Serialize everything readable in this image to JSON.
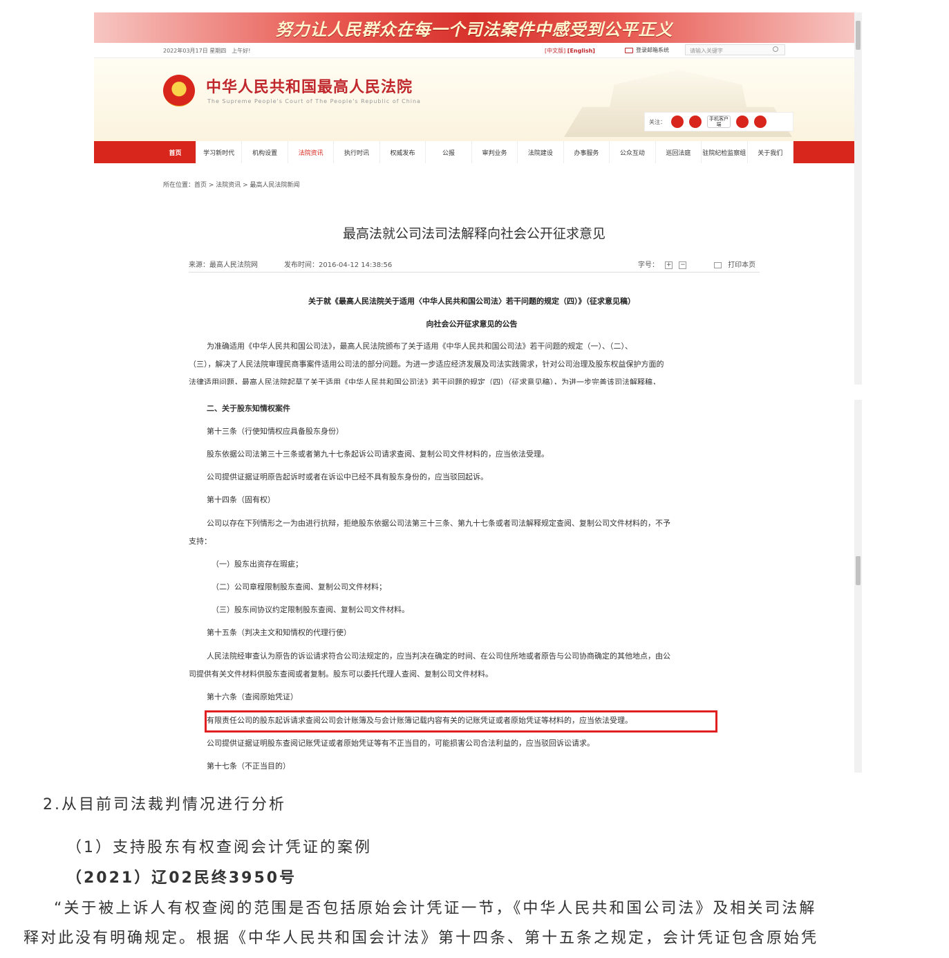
{
  "screenshot1": {
    "banner": "努力让人民群众在每一个司法案件中感受到公平正义",
    "topbar": {
      "date": "2022年03月17日 星期四　上午好!",
      "lang_cn": "[中文版]",
      "lang_en": "[English]",
      "mail": "登录邮箱系统",
      "search_placeholder": "请输入关键字"
    },
    "header": {
      "court_name": "中华人民共和国最高人民法院",
      "court_name_en": "The Supreme People's Court of The People's Republic of China",
      "follow_label": "关注：",
      "mobile_label": "手机客户端"
    },
    "nav": [
      "首页",
      "学习新时代",
      "机构设置",
      "法院资讯",
      "执行时讯",
      "权威发布",
      "公报",
      "审判业务",
      "法院建设",
      "办事服务",
      "公众互动",
      "巡回法庭",
      "驻院纪检监察组",
      "关于我们"
    ],
    "breadcrumb": "所在位置：首页 > 法院资讯 > 最高人民法院新闻",
    "article": {
      "title": "最高法就公司法司法解释向社会公开征求意见",
      "source": "来源：最高人民法院网",
      "time": "发布时间：2016-04-12 14:38:56",
      "font_label": "字号：",
      "font_plus": "+",
      "font_minus": "−",
      "print": "打印本页",
      "notice_title1": "关于就《最高人民法院关于适用〈中华人民共和国公司法〉若干问题的规定（四）》（征求意见稿）",
      "notice_title2": "向社会公开征求意见的公告",
      "para_line1": "为准确适用《中华人民共和国公司法》，最高人民法院颁布了关于适用《中华人民共和国公司法》若干问题的规定（一）、（二）、",
      "para_line2": "（三），解决了人民法院审理民商事案件适用公司法的部分问题。为进一步适应经济发展及司法实践需求，针对公司治理及股东权益保护方面的",
      "para_line3": "法律适用问题，最高人民法院起草了关于适用《中华人民共和国公司法》若干问题的规定（四）（征求意见稿），为进一步完善该司法解释稿，"
    }
  },
  "screenshot2": {
    "lines": [
      "二、关于股东知情权案件",
      "第十三条（行使知情权应具备股东身份）",
      "股东依据公司法第三十三条或者第九十七条起诉公司请求查阅、复制公司文件材料的，应当依法受理。",
      "公司提供证据证明原告起诉时或者在诉讼中已经不具有股东身份的，应当驳回起诉。",
      "第十四条（固有权）",
      "公司以存在下列情形之一为由进行抗辩，拒绝股东依据公司法第三十三条、第九十七条或者司法解释规定查阅、复制公司文件材料的，不予",
      "支持：",
      "（一）股东出资存在瑕疵；",
      "（二）公司章程限制股东查阅、复制公司文件材料；",
      "（三）股东间协议约定限制股东查阅、复制公司文件材料。",
      "第十五条（判决主文和知情权的代理行使）",
      "人民法院经审查认为原告的诉讼请求符合公司法规定的，应当判决在确定的时间、在公司住所地或者原告与公司协商确定的其他地点，由公",
      "司提供有关文件材料供股东查阅或者复制。股东可以委托代理人查阅、复制公司文件材料。",
      "第十六条（查阅原始凭证）",
      "有限责任公司的股东起诉请求查阅公司会计账簿及与会计账簿记载内容有关的记账凭证或者原始凭证等材料的，应当依法受理。",
      "公司提供证据证明股东查阅记账凭证或者原始凭证等有不正当目的，可能损害公司合法利益的，应当驳回诉讼请求。",
      "第十七条（不正当目的）"
    ]
  },
  "body": {
    "heading": "2.从目前司法裁判情况进行分析",
    "subheading": "（1）支持股东有权查阅会计凭证的案例",
    "case_number": "（2021）辽02民终3950号",
    "quote_line1": "“关于被上诉人有权查阅的范围是否包括原始会计凭证一节，《中华人民共和国公司法》及相关司法解",
    "quote_line2": "释对此没有明确规定。根据《中华人民共和国会计法》第十四条、第十五条之规定，会计凭证包含原始凭"
  },
  "colors": {
    "court_red": "#d9261c",
    "highlight_border": "#e02020"
  }
}
